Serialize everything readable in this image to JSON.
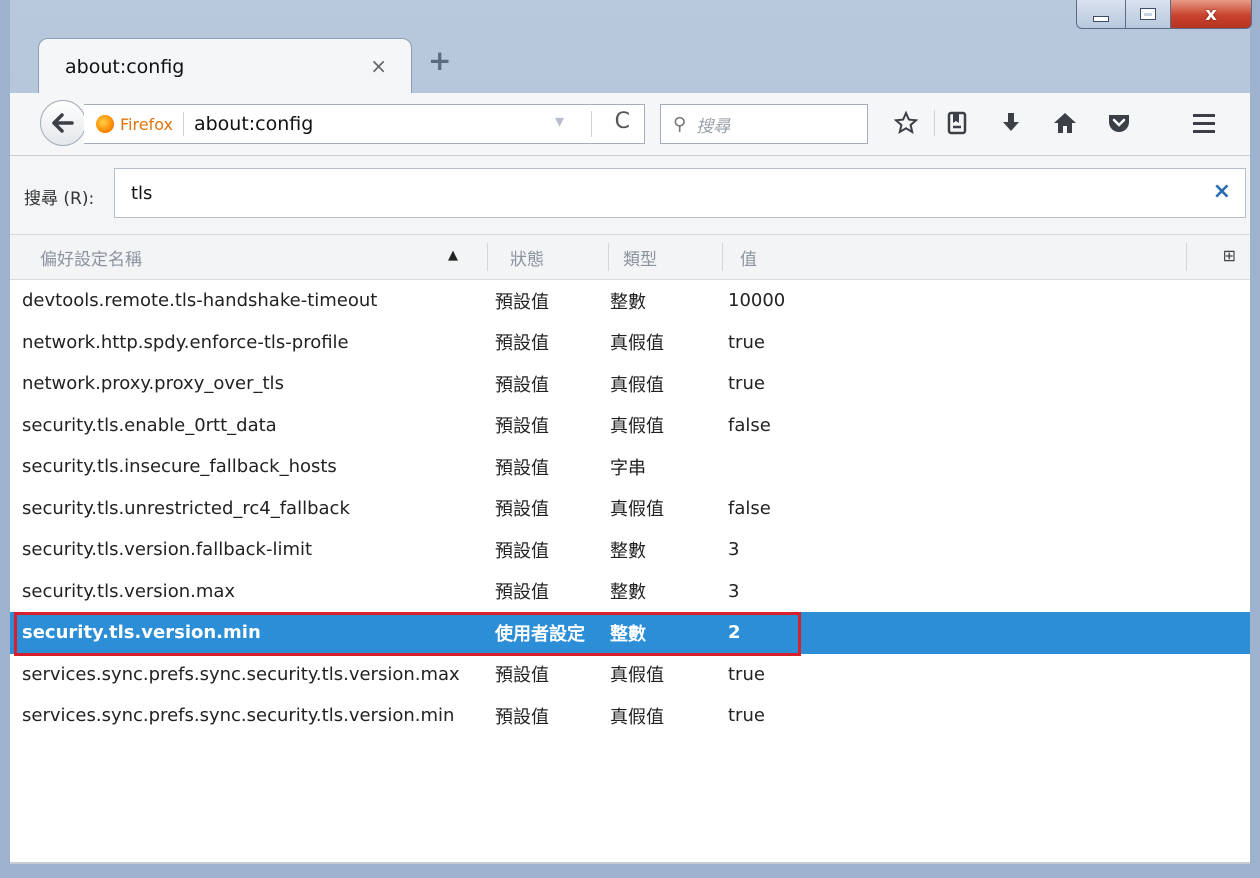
{
  "window": {
    "tab_title": "about:config",
    "tab_close": "×",
    "new_tab": "+",
    "caption_close": "x"
  },
  "toolbar": {
    "identity_label": "Firefox",
    "url": "about:config",
    "url_dropdown": "▾",
    "reload": "C",
    "search_placeholder": "搜尋",
    "search_glyph": "⚲",
    "icons": [
      "bookmark-star-icon",
      "reading-list-icon",
      "downloads-icon",
      "home-icon",
      "pocket-icon",
      "menu-icon"
    ]
  },
  "filter": {
    "label": "搜尋 (R):",
    "value": "tls",
    "clear": "×"
  },
  "columns": {
    "name": "偏好設定名稱",
    "status": "狀態",
    "type": "類型",
    "value": "值",
    "sort": "▲",
    "picker": "⊞"
  },
  "rows": [
    {
      "name": "devtools.remote.tls-handshake-timeout",
      "status": "預設值",
      "type": "整數",
      "value": "10000"
    },
    {
      "name": "network.http.spdy.enforce-tls-profile",
      "status": "預設值",
      "type": "真假值",
      "value": "true"
    },
    {
      "name": "network.proxy.proxy_over_tls",
      "status": "預設值",
      "type": "真假值",
      "value": "true"
    },
    {
      "name": "security.tls.enable_0rtt_data",
      "status": "預設值",
      "type": "真假值",
      "value": "false"
    },
    {
      "name": "security.tls.insecure_fallback_hosts",
      "status": "預設值",
      "type": "字串",
      "value": ""
    },
    {
      "name": "security.tls.unrestricted_rc4_fallback",
      "status": "預設值",
      "type": "真假值",
      "value": "false"
    },
    {
      "name": "security.tls.version.fallback-limit",
      "status": "預設值",
      "type": "整數",
      "value": "3"
    },
    {
      "name": "security.tls.version.max",
      "status": "預設值",
      "type": "整數",
      "value": "3"
    },
    {
      "name": "security.tls.version.min",
      "status": "使用者設定",
      "type": "整數",
      "value": "2"
    },
    {
      "name": "services.sync.prefs.sync.security.tls.version.max",
      "status": "預設值",
      "type": "真假值",
      "value": "true"
    },
    {
      "name": "services.sync.prefs.sync.security.tls.version.min",
      "status": "預設值",
      "type": "真假值",
      "value": "true"
    }
  ],
  "selected_row": 8,
  "colors": {
    "selection": "#2b8ed6",
    "highlight_box": "#d8202a",
    "identity": "#e2740b"
  }
}
